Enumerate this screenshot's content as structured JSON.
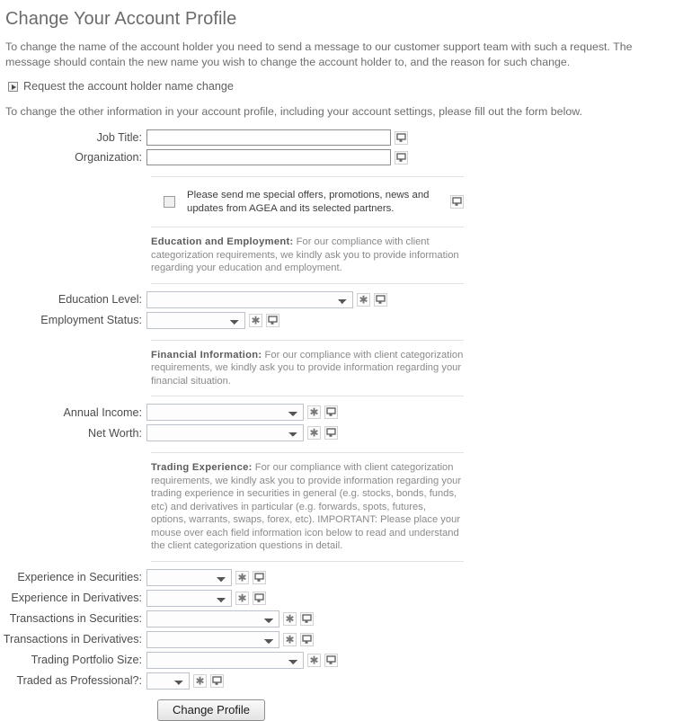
{
  "page": {
    "title": "Change Your Account Profile",
    "intro_paragraph": "To change the name of the account holder you need to send a message to our customer support team with such a request. The message should contain the new name you wish to change the account holder to, and the reason for such change.",
    "disclosure_label": "Request the account holder name change",
    "second_paragraph": "To change the other information in your account profile, including your account settings, please fill out the form below."
  },
  "form": {
    "job_title": {
      "label": "Job Title:",
      "value": "",
      "placeholder": ""
    },
    "organization": {
      "label": "Organization:",
      "value": "",
      "placeholder": ""
    },
    "optin": {
      "text": "Please send me special offers, promotions, news and updates from AGEA and its selected partners.",
      "checked": false
    },
    "notes": {
      "education_heading": "Education and Employment:",
      "education_body": " For our compliance with client categorization requirements, we kindly ask you to provide information regarding your education and employment.",
      "financial_heading": "Financial Information:",
      "financial_body": " For our compliance with client categorization requirements, we kindly ask you to provide information regarding your financial situation.",
      "trading_heading": "Trading Experience:",
      "trading_body": " For our compliance with client categorization requirements, we kindly ask you to provide information regarding your trading experience in securities in general (e.g. stocks, bonds, funds, etc) and derivatives in particular (e.g. forwards, spots, futures, options, warrants, swaps, forex, etc). IMPORTANT: Please place your mouse over each field information icon below to read and understand the client categorization questions in detail."
    },
    "education_level": {
      "label": "Education Level:",
      "value": "",
      "options": [
        ""
      ]
    },
    "employment_status": {
      "label": "Employment Status:",
      "value": "",
      "options": [
        ""
      ]
    },
    "annual_income": {
      "label": "Annual Income:",
      "value": "",
      "options": [
        ""
      ]
    },
    "net_worth": {
      "label": "Net Worth:",
      "value": "",
      "options": [
        ""
      ]
    },
    "experience_securities": {
      "label": "Experience in Securities:",
      "value": "",
      "options": [
        ""
      ]
    },
    "experience_derivatives": {
      "label": "Experience in Derivatives:",
      "value": "",
      "options": [
        ""
      ]
    },
    "transactions_securities": {
      "label": "Transactions in Securities:",
      "value": "",
      "options": [
        ""
      ]
    },
    "transactions_derivatives": {
      "label": "Transactions in Derivatives:",
      "value": "",
      "options": [
        ""
      ]
    },
    "trading_portfolio_size": {
      "label": "Trading Portfolio Size:",
      "value": "",
      "options": [
        ""
      ]
    },
    "traded_as_professional": {
      "label": "Traded as Professional?:",
      "value": "",
      "options": [
        ""
      ]
    },
    "submit_label": "Change Profile"
  },
  "icons": {
    "required": "asterisk-required-icon",
    "info": "tooltip-info-icon",
    "disclosure": "disclosure-triangle-icon"
  },
  "colors": {
    "heading": "#6b6b6b",
    "body_text": "#6d6d6d",
    "label": "#4d4d4d",
    "note_text": "#8a8a8a",
    "separator": "#e2e2e2",
    "input_border": "#8c8c8c",
    "select_border": "#bcc3cb"
  }
}
